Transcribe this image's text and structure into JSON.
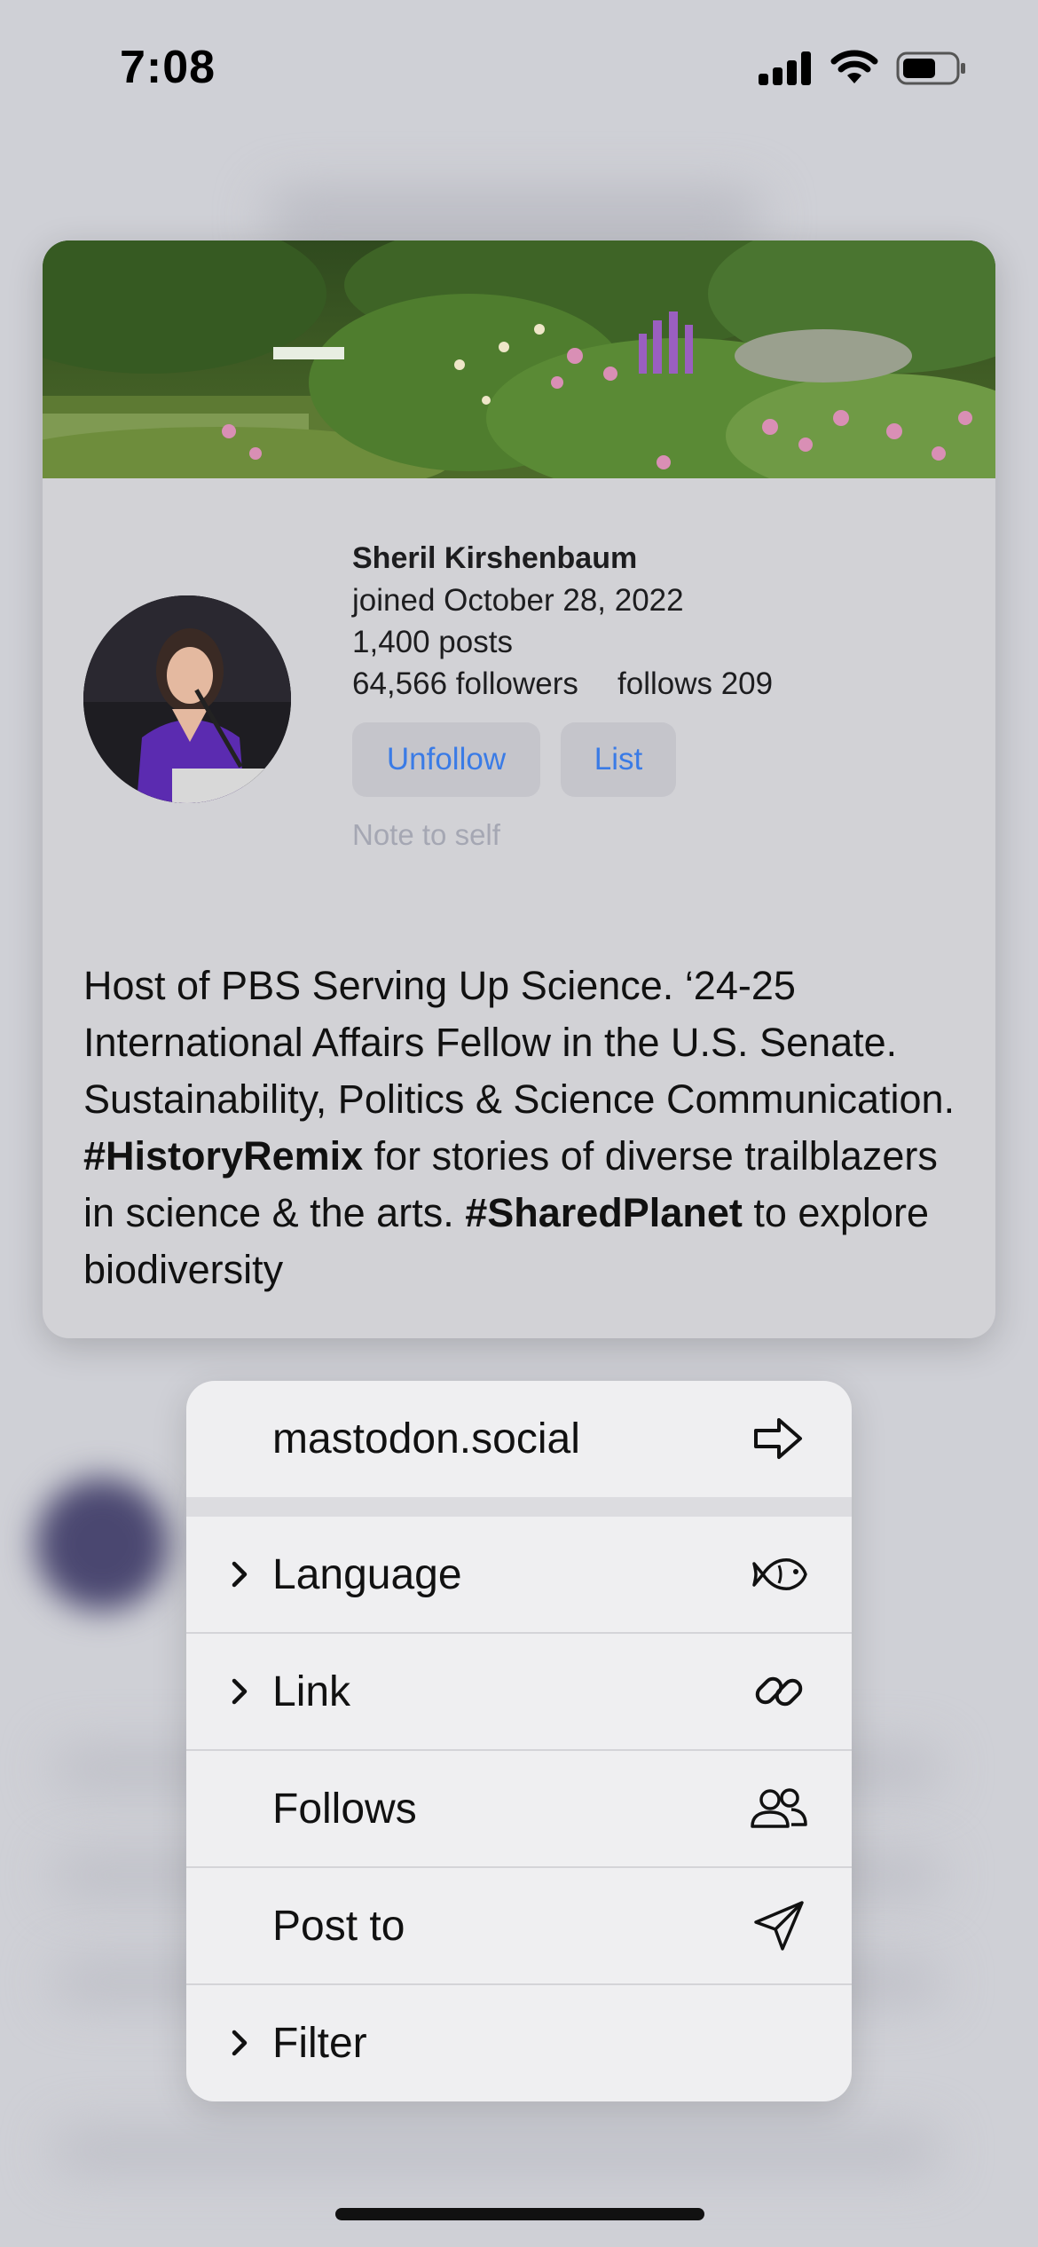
{
  "status_bar": {
    "time": "7:08"
  },
  "profile": {
    "name": "Sheril Kirshenbaum",
    "joined": "joined October 28, 2022",
    "posts": "1,400 posts",
    "followers": "64,566 followers",
    "follows": "follows 209",
    "unfollow_label": "Unfollow",
    "list_label": "List",
    "note_placeholder": "Note to self",
    "bio": {
      "part1": "Host of PBS Serving Up Science. ‘24-25 International Affairs Fellow in the U.S. Senate. Sustainability, Politics & Science Communication. ",
      "tag1": "#HistoryRemix",
      "part2": " for stories of diverse trailblazers in science & the arts. ",
      "tag2": "#SharedPlanet",
      "part3": " to explore biodiversity"
    }
  },
  "menu": {
    "items": [
      {
        "label": "mastodon.social",
        "icon": "arrow-right-icon",
        "submenu": false
      },
      {
        "label": "Language",
        "icon": "fish-icon",
        "submenu": true
      },
      {
        "label": "Link",
        "icon": "link-icon",
        "submenu": true
      },
      {
        "label": "Follows",
        "icon": "people-icon",
        "submenu": false
      },
      {
        "label": "Post to",
        "icon": "paper-plane-icon",
        "submenu": false
      },
      {
        "label": "Filter",
        "icon": "",
        "submenu": true
      }
    ]
  },
  "colors": {
    "accent": "#3a7be6",
    "card_bg": "#d2d2d6",
    "menu_bg": "#efeff1",
    "note_text": "#a5a7b3"
  }
}
